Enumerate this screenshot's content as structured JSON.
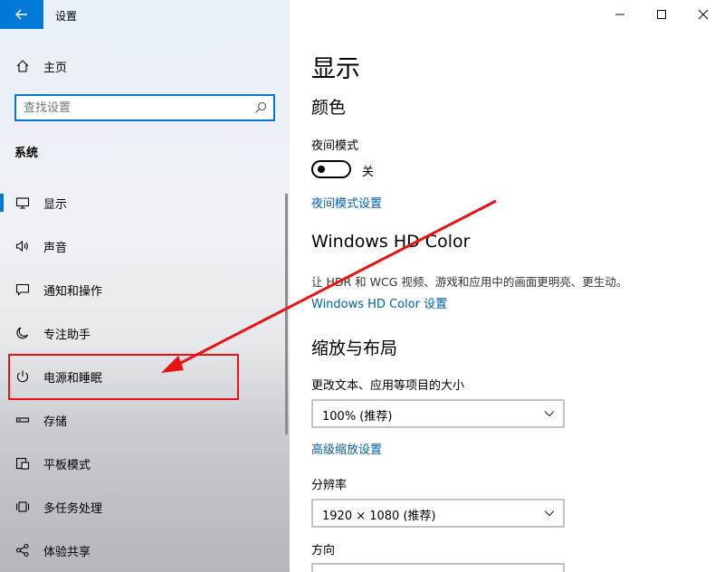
{
  "window": {
    "title": "设置"
  },
  "sidebar": {
    "home_label": "主页",
    "search_placeholder": "查找设置",
    "section_title": "系统",
    "items": [
      {
        "label": "显示",
        "icon": "monitor-icon",
        "active": true
      },
      {
        "label": "声音",
        "icon": "speaker-icon"
      },
      {
        "label": "通知和操作",
        "icon": "notification-icon"
      },
      {
        "label": "专注助手",
        "icon": "moon-icon"
      },
      {
        "label": "电源和睡眠",
        "icon": "power-icon",
        "highlighted": true
      },
      {
        "label": "存储",
        "icon": "storage-icon"
      },
      {
        "label": "平板模式",
        "icon": "tablet-icon"
      },
      {
        "label": "多任务处理",
        "icon": "multitask-icon"
      },
      {
        "label": "体验共享",
        "icon": "share-icon"
      }
    ]
  },
  "content": {
    "title": "显示",
    "color_heading": "颜色",
    "night_mode_label": "夜间模式",
    "night_mode_state": "关",
    "night_mode_settings_link": "夜间模式设置",
    "hd_color_heading": "Windows HD Color",
    "hd_color_desc": "让 HDR 和 WCG 视频、游戏和应用中的画面更明亮、更生动。",
    "hd_color_link": "Windows HD Color 设置",
    "scale_heading": "缩放与布局",
    "scale_label": "更改文本、应用等项目的大小",
    "scale_value": "100% (推荐)",
    "advanced_scale_link": "高级缩放设置",
    "resolution_label": "分辨率",
    "resolution_value": "1920 × 1080 (推荐)",
    "orientation_label": "方向"
  },
  "colors": {
    "accent": "#0078d7",
    "link": "#0060b0",
    "annotation": "#e11111"
  }
}
